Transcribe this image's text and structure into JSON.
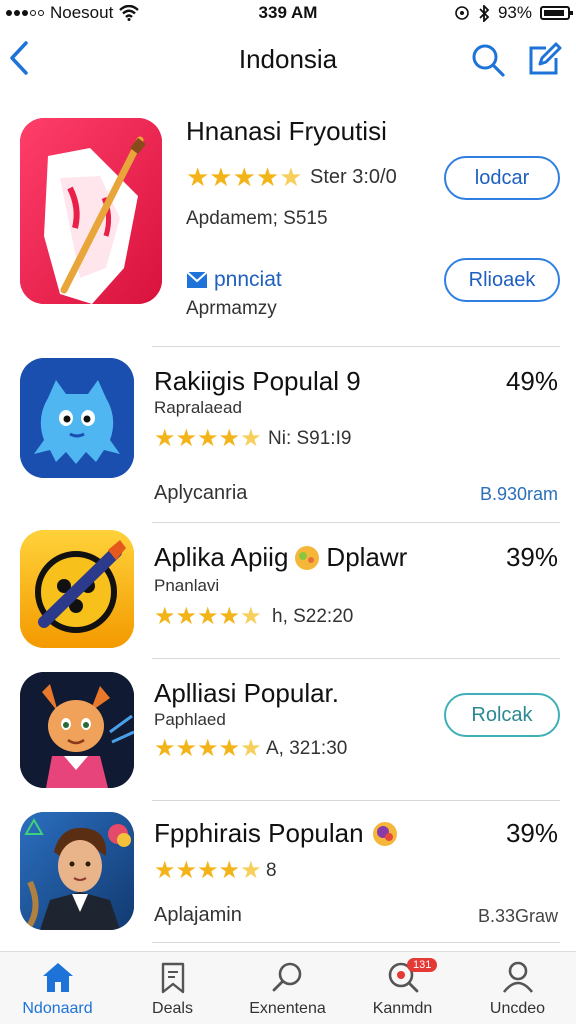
{
  "status": {
    "carrier": "Noesout",
    "time": "339 AM",
    "battery": "93%"
  },
  "nav": {
    "title": "Indonsia"
  },
  "featured": {
    "name": "Hnanasi Fryoutisi",
    "rating_text": "Ster 3:0/0",
    "meta1": "Apdamem; S515",
    "badge_text": "pnnciat",
    "meta2": "Aprmamzy",
    "button1": "lodcar",
    "button2": "Rlioaek",
    "colors": {
      "icon_bg": "#e8204a",
      "accent": "#2f7fe0"
    }
  },
  "apps": [
    {
      "name": "Rakiigis Populal 9",
      "sub": "Rapralaead",
      "rating_text": "Ni: S91:I9",
      "percent": "49%",
      "label": "Aplycanria",
      "size": "B.930ram"
    },
    {
      "name": "Aplika Apiig",
      "name_suffix": "Dplawr",
      "sub": "Pnanlavi",
      "rating_text": "h,  S22:20",
      "percent": "39%"
    },
    {
      "name": "Aplliasi Popular.",
      "sub": "Paphlaed",
      "rating_text": "A,   321:30",
      "button": "Rolcak"
    },
    {
      "name": "Fpphirais Populan",
      "rating_text": "8",
      "percent": "39%",
      "label": "Aplajamin",
      "size": "B.33Graw"
    }
  ],
  "tabs": [
    {
      "label": "Ndonaard",
      "icon": "home-icon",
      "active": true
    },
    {
      "label": "Deals",
      "icon": "deals-icon"
    },
    {
      "label": "Exnentena",
      "icon": "search-icon"
    },
    {
      "label": "Kanmdn",
      "icon": "notifications-icon",
      "badge": "131"
    },
    {
      "label": "Uncdeo",
      "icon": "profile-icon"
    }
  ]
}
